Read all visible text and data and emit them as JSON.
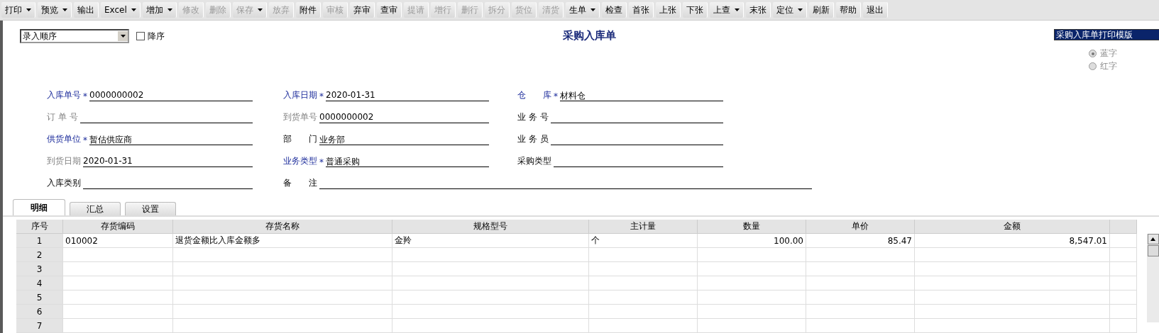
{
  "toolbar": [
    {
      "label": "打印",
      "dropdown": true,
      "disabled": false
    },
    {
      "label": "预览",
      "dropdown": true,
      "disabled": false
    },
    {
      "label": "输出",
      "dropdown": false,
      "disabled": false
    },
    {
      "label": "Excel",
      "dropdown": true,
      "disabled": false
    },
    {
      "label": "增加",
      "dropdown": true,
      "disabled": false
    },
    {
      "label": "修改",
      "dropdown": false,
      "disabled": true
    },
    {
      "label": "删除",
      "dropdown": false,
      "disabled": true
    },
    {
      "label": "保存",
      "dropdown": true,
      "disabled": true
    },
    {
      "label": "放弃",
      "dropdown": false,
      "disabled": true
    },
    {
      "label": "附件",
      "dropdown": false,
      "disabled": false
    },
    {
      "label": "审核",
      "dropdown": false,
      "disabled": true
    },
    {
      "label": "弃审",
      "dropdown": false,
      "disabled": false
    },
    {
      "label": "查审",
      "dropdown": false,
      "disabled": false
    },
    {
      "label": "提请",
      "dropdown": false,
      "disabled": true
    },
    {
      "label": "增行",
      "dropdown": false,
      "disabled": true
    },
    {
      "label": "删行",
      "dropdown": false,
      "disabled": true
    },
    {
      "label": "拆分",
      "dropdown": false,
      "disabled": true
    },
    {
      "label": "货位",
      "dropdown": false,
      "disabled": true
    },
    {
      "label": "清货",
      "dropdown": false,
      "disabled": true
    },
    {
      "label": "生单",
      "dropdown": true,
      "disabled": false
    },
    {
      "label": "检查",
      "dropdown": false,
      "disabled": false
    },
    {
      "label": "首张",
      "dropdown": false,
      "disabled": false
    },
    {
      "label": "上张",
      "dropdown": false,
      "disabled": false
    },
    {
      "label": "下张",
      "dropdown": false,
      "disabled": false
    },
    {
      "label": "上查",
      "dropdown": true,
      "disabled": false
    },
    {
      "label": "末张",
      "dropdown": false,
      "disabled": false
    },
    {
      "label": "定位",
      "dropdown": true,
      "disabled": false
    },
    {
      "label": "刷新",
      "dropdown": false,
      "disabled": false
    },
    {
      "label": "帮助",
      "dropdown": false,
      "disabled": false
    },
    {
      "label": "退出",
      "dropdown": false,
      "disabled": false
    }
  ],
  "sort": {
    "value": "录入顺序",
    "descending": {
      "label": "降序",
      "checked": false
    }
  },
  "title": "采购入库单",
  "template": {
    "value": "采购入库单打印模版"
  },
  "color_mode": [
    {
      "label": "蓝字",
      "selected": true,
      "disabled": true
    },
    {
      "label": "红字",
      "selected": false,
      "disabled": true
    }
  ],
  "fields": [
    {
      "label": "入库单号",
      "required_mark": "*",
      "value": "0000000002",
      "required": true,
      "disabled": false
    },
    {
      "label": "入库日期",
      "required_mark": "*",
      "value": "2020-01-31",
      "required": true,
      "disabled": false
    },
    {
      "label": "仓　　库",
      "required_mark": "*",
      "value": "材料仓",
      "required": true,
      "disabled": false
    },
    {
      "label": "订 单 号",
      "required": false,
      "disabled": true
    },
    {
      "label": "到货单号",
      "value": "0000000002",
      "required": false,
      "disabled": true
    },
    {
      "label": "业 务 号",
      "required": false,
      "disabled": false
    },
    {
      "label": "供货单位",
      "required_mark": "*",
      "value": "暂估供应商",
      "required": true,
      "disabled": false
    },
    {
      "label": "部　　门",
      "value": "业务部",
      "required": false,
      "disabled": false
    },
    {
      "label": "业 务 员",
      "required": false,
      "disabled": false
    },
    {
      "label": "到货日期",
      "value": "2020-01-31",
      "required": false,
      "disabled": true
    },
    {
      "label": "业务类型",
      "required_mark": "*",
      "value": "普通采购",
      "required": true,
      "disabled": false
    },
    {
      "label": "采购类型",
      "required": false,
      "disabled": false
    },
    {
      "label": "入库类别",
      "required": false,
      "disabled": false
    },
    {
      "label": "备　　注",
      "required": false,
      "disabled": false,
      "wide": true
    }
  ],
  "tabs": [
    {
      "label": "明细",
      "selected": true
    },
    {
      "label": "汇总",
      "selected": false
    },
    {
      "label": "设置",
      "selected": false
    }
  ],
  "table": {
    "columns": [
      {
        "label": "序号",
        "kind": "index"
      },
      {
        "label": "存货编码",
        "kind": "text"
      },
      {
        "label": "存货名称",
        "kind": "text"
      },
      {
        "label": "规格型号",
        "kind": "text"
      },
      {
        "label": "主计量",
        "kind": "text"
      },
      {
        "label": "数量",
        "kind": "number"
      },
      {
        "label": "单价",
        "kind": "number"
      },
      {
        "label": "金额",
        "kind": "number"
      }
    ],
    "rows": [
      [
        "1",
        "010002",
        "退货金额比入库金额多",
        "金羚",
        "个",
        "100.00",
        "85.47",
        "8,547.01"
      ],
      [
        "2",
        "",
        "",
        "",
        "",
        "",
        "",
        ""
      ],
      [
        "3",
        "",
        "",
        "",
        "",
        "",
        "",
        ""
      ],
      [
        "4",
        "",
        "",
        "",
        "",
        "",
        "",
        ""
      ],
      [
        "5",
        "",
        "",
        "",
        "",
        "",
        "",
        ""
      ],
      [
        "6",
        "",
        "",
        "",
        "",
        "",
        "",
        ""
      ],
      [
        "7",
        "",
        "",
        "",
        "",
        "",
        "",
        ""
      ]
    ]
  }
}
